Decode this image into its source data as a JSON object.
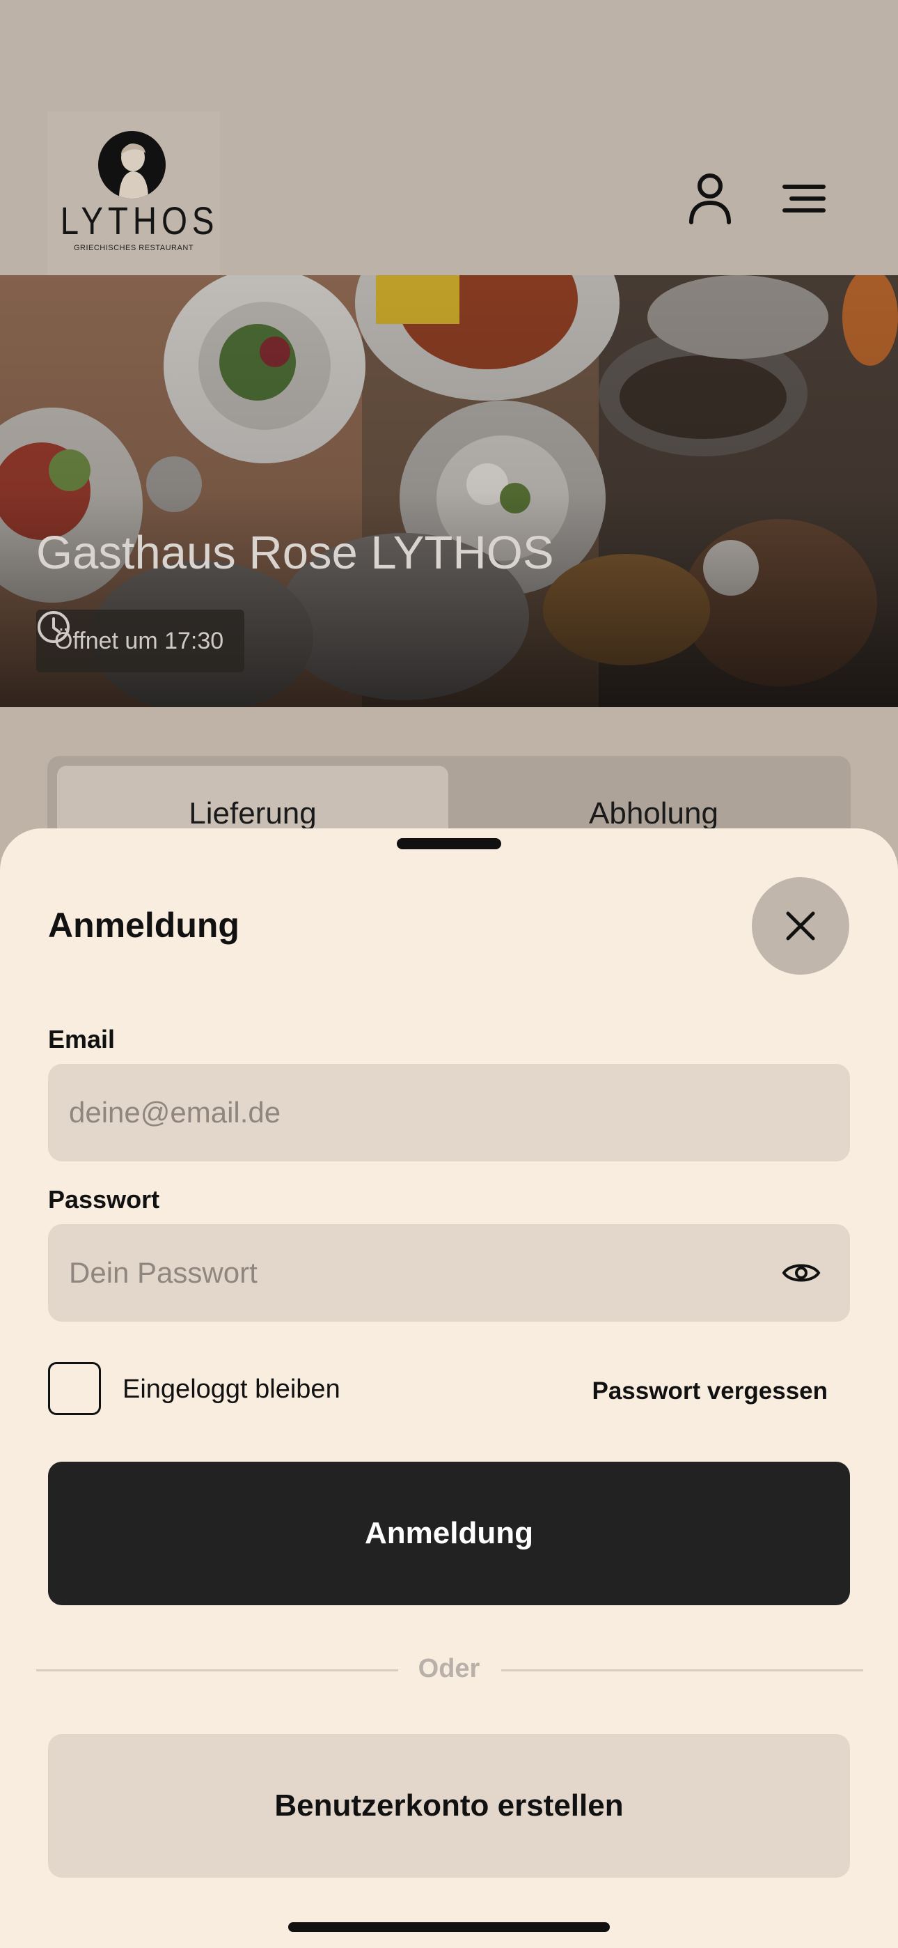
{
  "header": {
    "logo_name": "LYTHOS",
    "logo_subtitle": "GRIECHISCHES RESTAURANT",
    "user_icon": "user-icon",
    "menu_icon": "menu-icon"
  },
  "hero": {
    "title": "Gasthaus Rose LYTHOS",
    "opening_status": "Öffnet um 17:30",
    "status_icon": "clock-icon"
  },
  "tabs": [
    {
      "label": "Lieferung",
      "active": true
    },
    {
      "label": "Abholung",
      "active": false
    }
  ],
  "login_sheet": {
    "title": "Anmeldung",
    "close_icon": "close-icon",
    "email": {
      "label": "Email",
      "placeholder": "deine@email.de",
      "value": ""
    },
    "password": {
      "label": "Passwort",
      "placeholder": "Dein Passwort",
      "value": "",
      "toggle_icon": "eye-icon"
    },
    "remember": {
      "label": "Eingeloggt bleiben",
      "checked": false
    },
    "forgot_password": "Passwort vergessen",
    "submit_label": "Anmeldung",
    "divider_text": "Oder",
    "create_account_label": "Benutzerkonto erstellen"
  },
  "colors": {
    "sheet_background": "#f9ede0",
    "input_background": "#e3d7cb",
    "primary_button": "#232223",
    "overlay_background": "#bfb3a8"
  }
}
